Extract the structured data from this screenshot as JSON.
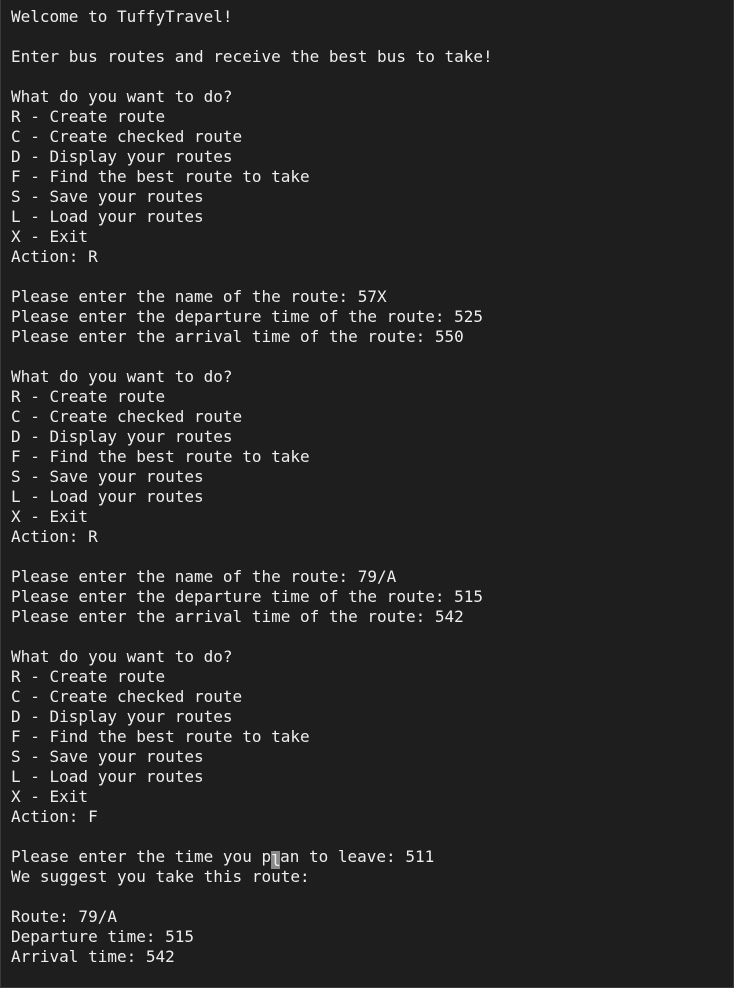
{
  "terminal": {
    "lines": [
      "Welcome to TuffyTravel!",
      "",
      "Enter bus routes and receive the best bus to take!",
      "",
      "What do you want to do?",
      "R - Create route",
      "C - Create checked route",
      "D - Display your routes",
      "F - Find the best route to take",
      "S - Save your routes",
      "L - Load your routes",
      "X - Exit",
      "Action: R",
      "",
      "Please enter the name of the route: 57X",
      "Please enter the departure time of the route: 525",
      "Please enter the arrival time of the route: 550",
      "",
      "What do you want to do?",
      "R - Create route",
      "C - Create checked route",
      "D - Display your routes",
      "F - Find the best route to take",
      "S - Save your routes",
      "L - Load your routes",
      "X - Exit",
      "Action: R",
      "",
      "Please enter the name of the route: 79/A",
      "Please enter the departure time of the route: 515",
      "Please enter the arrival time of the route: 542",
      "",
      "What do you want to do?",
      "R - Create route",
      "C - Create checked route",
      "D - Display your routes",
      "F - Find the best route to take",
      "S - Save your routes",
      "L - Load your routes",
      "X - Exit",
      "Action: F",
      "",
      "Please enter the time you p",
      "We suggest you take this route:",
      "",
      "Route: 79/A",
      "Departure time: 515",
      "Arrival time: 542"
    ],
    "cursor_line": {
      "before": "Please enter the time you p",
      "cursor_char": "l",
      "after": "an to leave: 511"
    }
  }
}
